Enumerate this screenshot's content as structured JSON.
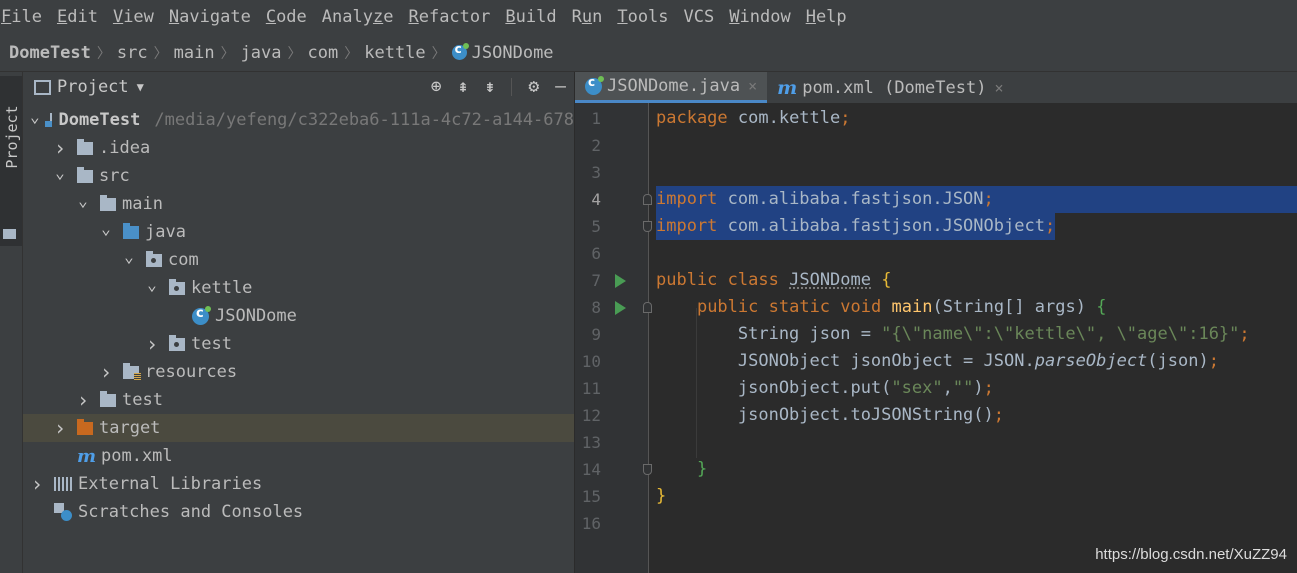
{
  "menu": [
    "File",
    "Edit",
    "View",
    "Navigate",
    "Code",
    "Analyze",
    "Refactor",
    "Build",
    "Run",
    "Tools",
    "VCS",
    "Window",
    "Help"
  ],
  "breadcrumb": [
    "DomeTest",
    "src",
    "main",
    "java",
    "com",
    "kettle",
    "JSONDome"
  ],
  "sidebar_tab_label": "Project",
  "project_panel": {
    "title": "Project",
    "dropdown_icon": "caret-down-icon",
    "tools": [
      "locate-icon",
      "expand-all-icon",
      "collapse-all-icon",
      "gear-icon",
      "hide-icon"
    ],
    "tree": [
      {
        "label": "DomeTest",
        "path": "/media/yefeng/c322eba6-111a-4c72-a144-678",
        "icon": "module-icon",
        "arrow": "down",
        "indent": 0,
        "bold": true
      },
      {
        "label": ".idea",
        "icon": "folder-icon",
        "arrow": "right",
        "indent": 1
      },
      {
        "label": "src",
        "icon": "folder-icon",
        "arrow": "down",
        "indent": 1
      },
      {
        "label": "main",
        "icon": "folder-icon",
        "arrow": "down",
        "indent": 2
      },
      {
        "label": "java",
        "icon": "source-folder-icon",
        "arrow": "down",
        "indent": 3
      },
      {
        "label": "com",
        "icon": "package-icon",
        "arrow": "down",
        "indent": 4
      },
      {
        "label": "kettle",
        "icon": "package-icon",
        "arrow": "down",
        "indent": 5
      },
      {
        "label": "JSONDome",
        "icon": "class-icon",
        "arrow": "none",
        "indent": 6
      },
      {
        "label": "test",
        "icon": "package-icon",
        "arrow": "right",
        "indent": 5
      },
      {
        "label": "resources",
        "icon": "resources-folder-icon",
        "arrow": "right",
        "indent": 3
      },
      {
        "label": "test",
        "icon": "folder-icon",
        "arrow": "right",
        "indent": 2
      },
      {
        "label": "target",
        "icon": "excluded-folder-icon",
        "arrow": "right",
        "indent": 1,
        "selected": true
      },
      {
        "label": "pom.xml",
        "icon": "maven-icon",
        "arrow": "none",
        "indent": 1
      },
      {
        "label": "External Libraries",
        "icon": "libraries-icon",
        "arrow": "right",
        "indent": 0
      },
      {
        "label": "Scratches and Consoles",
        "icon": "scratches-icon",
        "arrow": "none",
        "indent": 0
      }
    ]
  },
  "editor_tabs": [
    {
      "label": "JSONDome.java",
      "icon": "class-icon",
      "active": true,
      "close": "×"
    },
    {
      "label": "pom.xml (DomeTest)",
      "icon": "maven-icon",
      "active": false,
      "close": "×"
    }
  ],
  "code": {
    "line_numbers": [
      "1",
      "2",
      "3",
      "4",
      "5",
      "6",
      "7",
      "8",
      "9",
      "10",
      "11",
      "12",
      "13",
      "14",
      "15",
      "16"
    ],
    "lines": [
      "package com.kettle;",
      "",
      "",
      "import com.alibaba.fastjson.JSON;",
      "import com.alibaba.fastjson.JSONObject;",
      "",
      "public class JSONDome {",
      "    public static void main(String[] args) {",
      "        String json = \"{\\\"name\\\":\\\"kettle\\\", \\\"age\\\":16}\";",
      "        JSONObject jsonObject = JSON.parseObject(json);",
      "        jsonObject.put(\"sex\",\"\");",
      "        jsonObject.toJSONString();",
      "",
      "    }",
      "}",
      ""
    ],
    "selected_lines": [
      4,
      5
    ],
    "run_lines": [
      7,
      8
    ],
    "colors": {
      "keyword": "#cc7832",
      "string": "#6a8759",
      "method": "#ffc66d",
      "selection": "#214283"
    }
  },
  "watermark": "https://blog.csdn.net/XuZZ94"
}
